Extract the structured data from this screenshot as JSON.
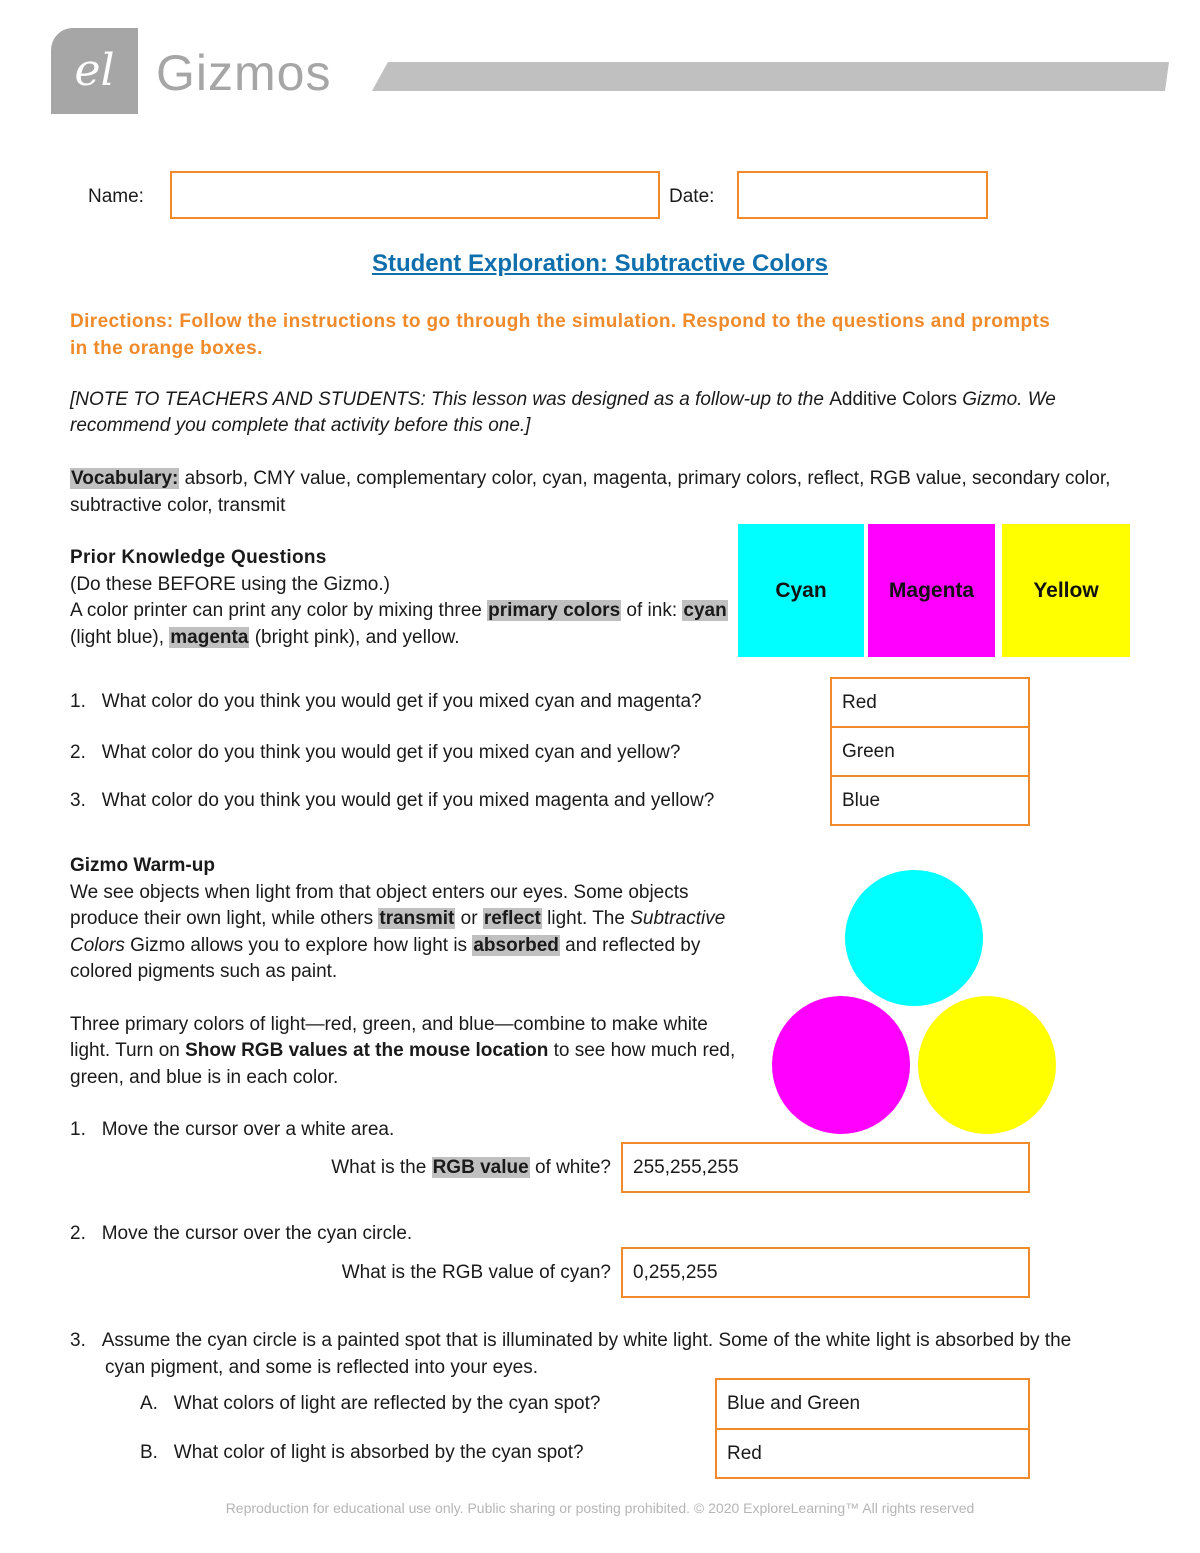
{
  "header": {
    "logo_glyph": "el",
    "brand": "Gizmos"
  },
  "form": {
    "name_label": "Name:",
    "name_value": "",
    "date_label": "Date:",
    "date_value": ""
  },
  "title": "Student Exploration: Subtractive Colors",
  "directions": "Directions: Follow the instructions to go through the simulation. Respond to the questions and prompts in the orange boxes.",
  "note": {
    "part1": "[NOTE TO TEACHERS AND STUDENTS: This lesson was designed as a follow-up to the ",
    "link": "Additive Colors",
    "part2": " Gizmo. We recommend you complete that activity before this one.]"
  },
  "vocabulary": {
    "label": "Vocabulary:",
    "text": " absorb, CMY value, complementary color, cyan, magenta, primary colors, reflect, RGB value, secondary color, subtractive color, transmit"
  },
  "prior_knowledge": {
    "heading": "Prior Knowledge Questions",
    "subheading": "(Do these BEFORE using the Gizmo.)",
    "intro_1": "A color printer can print any color by mixing three ",
    "term_primary": "primary colors",
    "intro_2": " of ink: ",
    "term_cyan": "cyan",
    "intro_3": " (light blue), ",
    "term_magenta": "magenta",
    "intro_4": " (bright pink), and yellow.",
    "swatches": [
      {
        "label": "Cyan",
        "color": "#00ffff"
      },
      {
        "label": "Magenta",
        "color": "#ff00ff"
      },
      {
        "label": "Yellow",
        "color": "#ffff00"
      }
    ],
    "questions": [
      {
        "num": "1.",
        "text": "What color do you think you would get if you mixed cyan and magenta?",
        "answer": "Red"
      },
      {
        "num": "2.",
        "text": "What color do you think you would get if you mixed cyan and yellow?",
        "answer": "Green"
      },
      {
        "num": "3.",
        "text": "What color do you think you would get if you mixed magenta and yellow?",
        "answer": "Blue"
      }
    ]
  },
  "warmup": {
    "heading": "Gizmo Warm-up",
    "p1_a": "We see objects when light from that object enters our eyes. Some objects produce their own light, while others ",
    "term_transmit": "transmit",
    "p1_b": " or ",
    "term_reflect": "reflect",
    "p1_c": " light. The ",
    "p1_italic": "Subtractive Colors",
    "p1_d": " Gizmo allows you to explore how light is ",
    "term_absorbed": "absorbed",
    "p1_e": " and reflected by colored pigments such as paint.",
    "p2_a": "Three primary colors of light—red, green, and blue—combine to make white light. Turn on ",
    "p2_bold": "Show RGB values at the mouse location",
    "p2_b": " to see how much red, green, and blue is in each color.",
    "circles": [
      {
        "name": "cyan",
        "color": "#00ffff"
      },
      {
        "name": "magenta",
        "color": "#ff00ff"
      },
      {
        "name": "yellow",
        "color": "#ffff00"
      }
    ],
    "q1": {
      "num": "1.",
      "text": "Move the cursor over a white area.",
      "prompt_a": "What is the ",
      "prompt_term": "RGB value",
      "prompt_b": " of white?",
      "answer": "255,255,255"
    },
    "q2": {
      "num": "2.",
      "text": "Move the cursor over the cyan circle.",
      "prompt": "What is the RGB value of cyan?",
      "answer": "0,255,255"
    },
    "q3": {
      "num": "3.",
      "text": "Assume the cyan circle is a painted spot that is illuminated by white light. Some of the white light is absorbed by the cyan pigment, and some is reflected into your eyes.",
      "sub": [
        {
          "num": "A.",
          "text": "What colors of light are reflected by the cyan spot?",
          "answer": "Blue and Green"
        },
        {
          "num": "B.",
          "text": "What color of light is absorbed by the cyan spot?",
          "answer": "Red"
        }
      ]
    }
  },
  "footer": "Reproduction for educational use only. Public sharing or posting prohibited. © 2020 ExploreLearning™ All rights reserved",
  "colors": {
    "accent_orange": "#f08a2a",
    "title_blue": "#0f6fad",
    "highlight_gray": "#c0c0c0"
  }
}
